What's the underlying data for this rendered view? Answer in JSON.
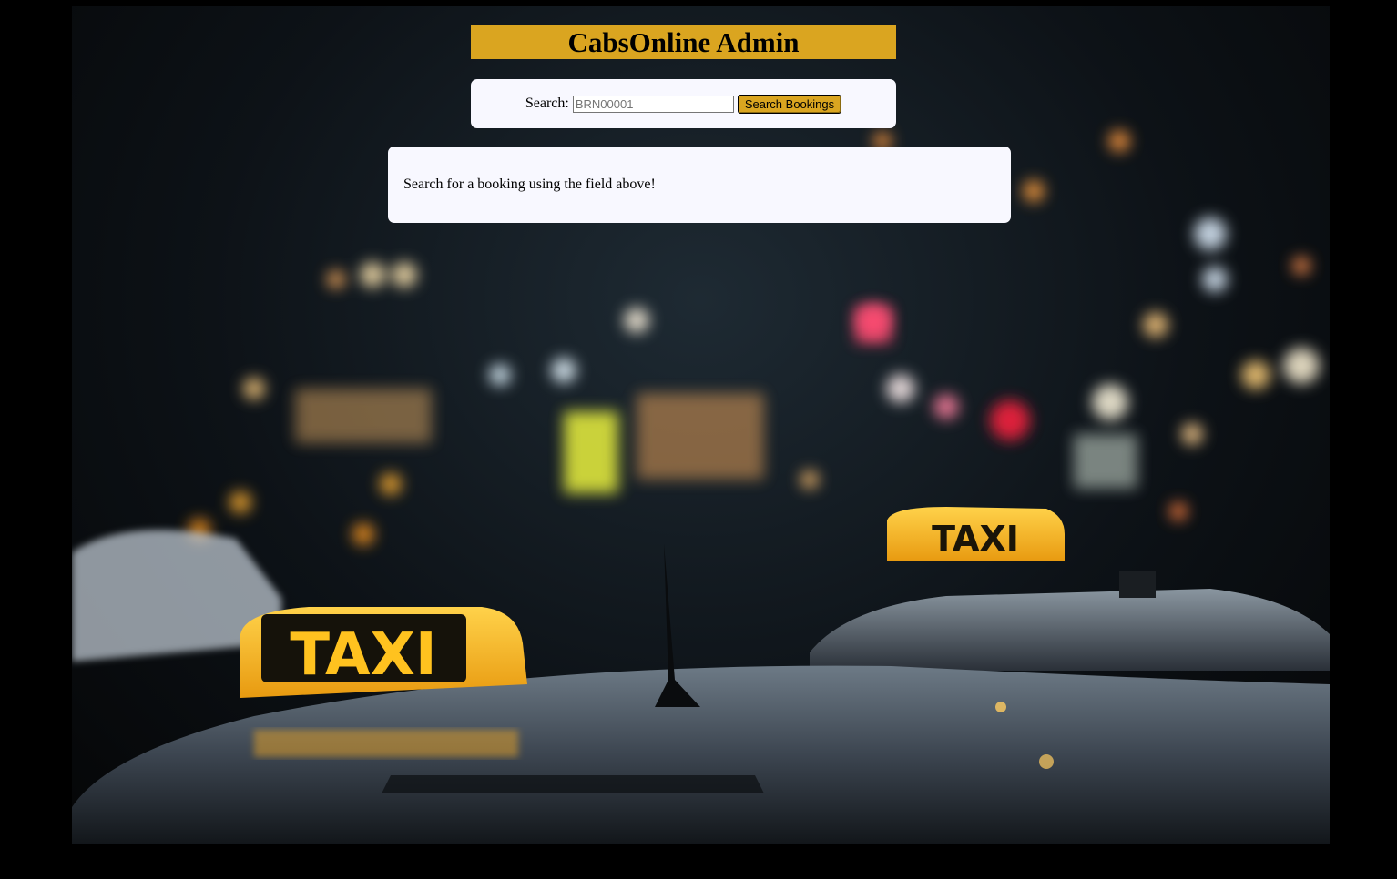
{
  "header": {
    "title": "CabsOnline Admin"
  },
  "search": {
    "label": "Search:",
    "placeholder": "BRN00001",
    "value": "",
    "button_label": "Search Bookings"
  },
  "results": {
    "message": "Search for a booking using the field above!"
  },
  "background": {
    "sign_text_front": "TAXI",
    "sign_text_back": "TAXI"
  },
  "colors": {
    "accent": "#daa520",
    "panel": "#f8f8ff",
    "page_background": "#000000"
  }
}
